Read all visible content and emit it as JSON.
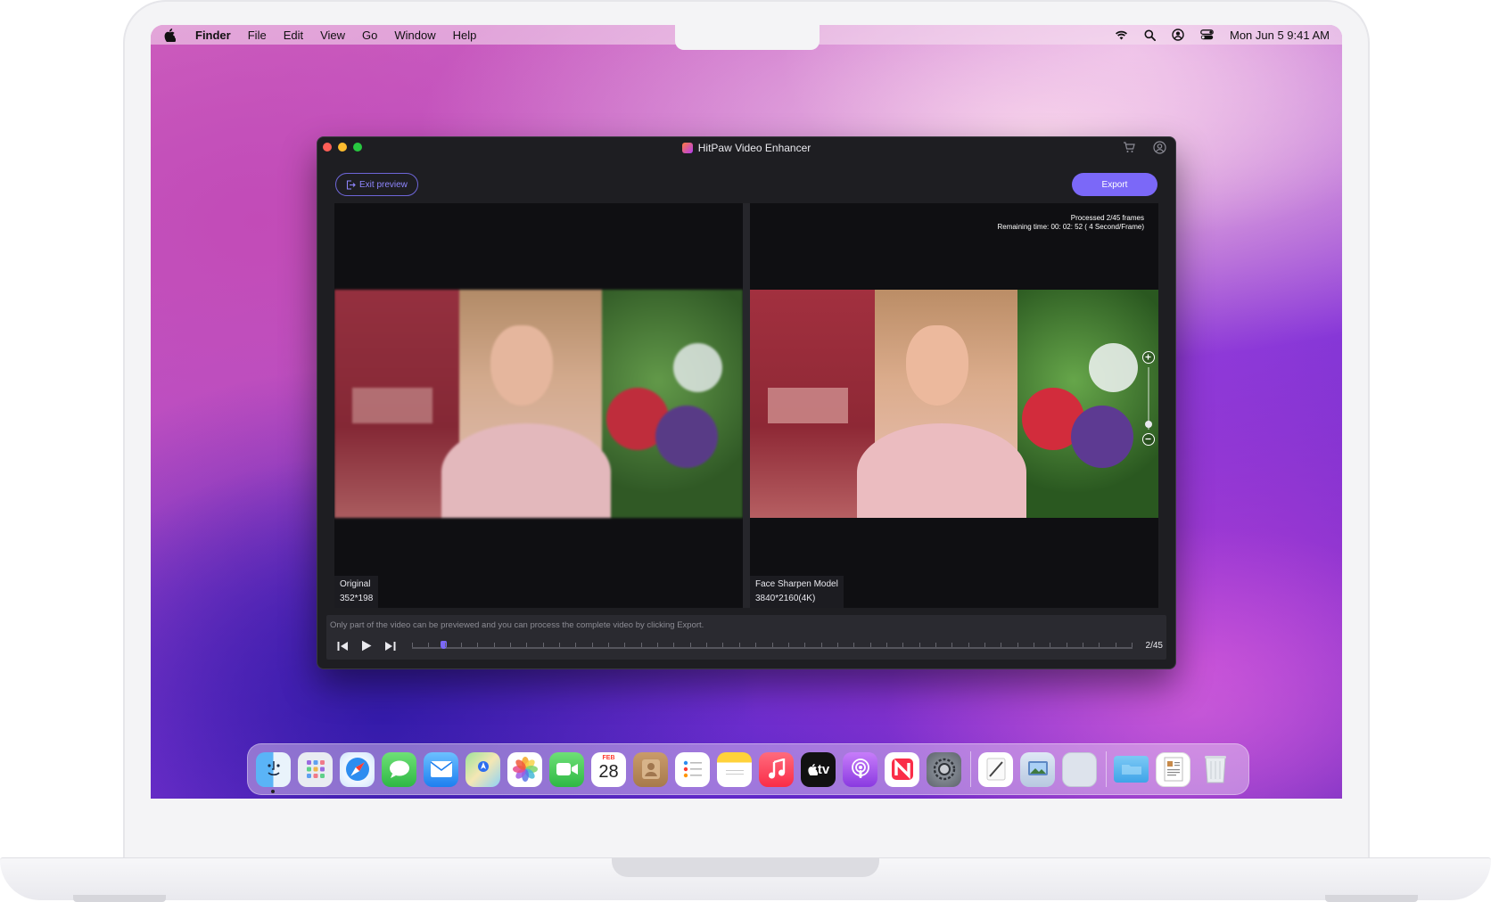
{
  "menubar": {
    "items": [
      "Finder",
      "File",
      "Edit",
      "View",
      "Go",
      "Window",
      "Help"
    ],
    "clock": "Mon Jun 5  9:41 AM"
  },
  "window": {
    "title": "HitPaw Video Enhancer",
    "exit_preview": "Exit preview",
    "export": "Export",
    "processed": "Processed 2/45 frames",
    "remaining": "Remaining time: 00: 02: 52 ( 4 Second/Frame)",
    "original_label": "Original",
    "original_res": "352*198",
    "model_label": "Face Sharpen Model",
    "model_res": "3840*2160(4K)",
    "notice": "Only part of the video can be previewed and you can process the complete video by clicking Export.",
    "frame_count": "2/45",
    "progress_fraction": 0.022
  },
  "dock": {
    "calendar_month": "FEB",
    "calendar_day": "28",
    "tv_label": "tv"
  },
  "colors": {
    "accent": "#7b68f8",
    "window_bg": "#1e1e22"
  }
}
